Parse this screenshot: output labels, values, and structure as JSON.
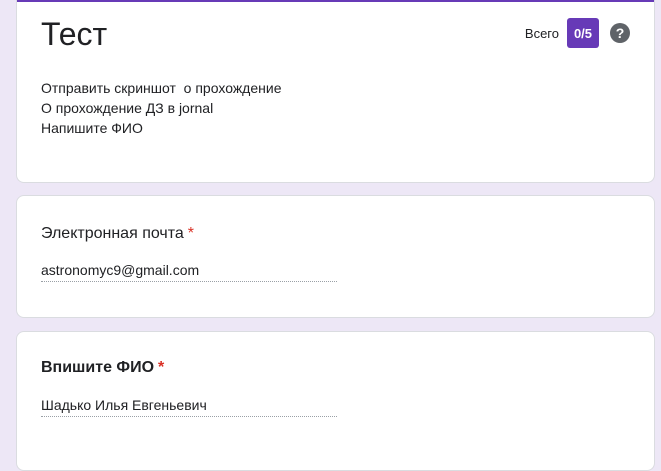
{
  "form": {
    "title": "Тест",
    "score_label": "Всего",
    "score_value": "0/5",
    "help_glyph": "?",
    "description": [
      "Отправить скриншот  о прохождение",
      "О прохождение ДЗ в jornal",
      "Напишите ФИО"
    ]
  },
  "questions": [
    {
      "title": "Электронная почта",
      "required_mark": "*",
      "answer": "astronomyc9@gmail.com"
    },
    {
      "title": "Впишите ФИО",
      "required_mark": "*",
      "answer": "Шадько Илья Евгеньевич"
    }
  ],
  "colors": {
    "accent": "#673ab7",
    "background": "#ede7f6",
    "required": "#d93025"
  },
  "icons": {
    "help": "help-circle-icon"
  }
}
